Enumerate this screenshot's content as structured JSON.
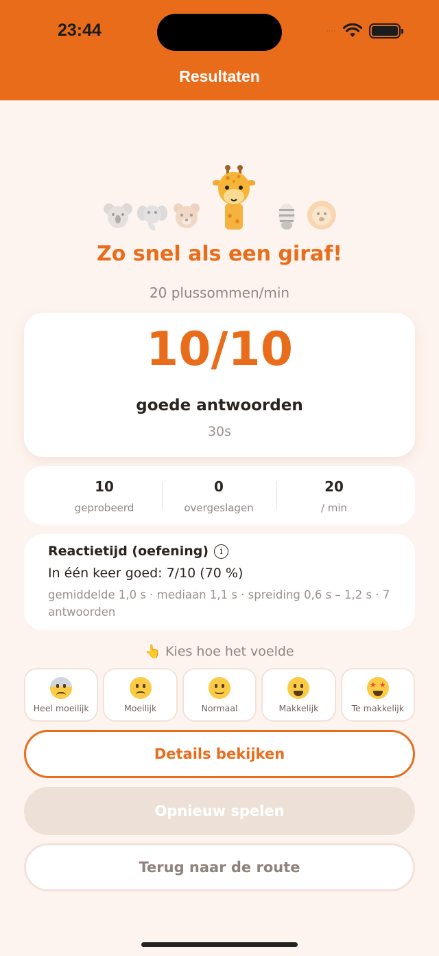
{
  "status_bar": {
    "time": "23:44"
  },
  "header": {
    "title": "Resultaten"
  },
  "result": {
    "title": "Zo snel als een giraf!",
    "rate": "20 plussommen/min"
  },
  "score": {
    "value": "10/10",
    "label": "goede antwoorden",
    "time": "30s"
  },
  "stats": [
    {
      "value": "10",
      "label": "geprobeerd"
    },
    {
      "value": "0",
      "label": "overgeslagen"
    },
    {
      "value": "20",
      "label": "/ min"
    }
  ],
  "reaction": {
    "title": "Reactietijd (oefening)",
    "info_icon": "i",
    "main": "In één keer goed: 7/10 (70 %)",
    "detail": "gemiddelde 1,0 s · mediaan 1,1 s · spreiding 0,6 s – 1,2 s · 7 antwoorden"
  },
  "feeling": {
    "prompt": "👆 Kies hoe het voelde",
    "options": [
      {
        "label": "Heel moeilijk",
        "icon": "anxious-face-icon"
      },
      {
        "label": "Moeilijk",
        "icon": "confused-face-icon"
      },
      {
        "label": "Normaal",
        "icon": "slight-smile-face-icon"
      },
      {
        "label": "Makkelijk",
        "icon": "grin-face-icon"
      },
      {
        "label": "Te makkelijk",
        "icon": "star-struck-face-icon"
      }
    ]
  },
  "buttons": {
    "details": "Details bekijken",
    "replay": "Opnieuw spelen",
    "back": "Terug naar de route"
  },
  "colors": {
    "accent": "#E96C1B",
    "background": "#FDF4EF"
  }
}
